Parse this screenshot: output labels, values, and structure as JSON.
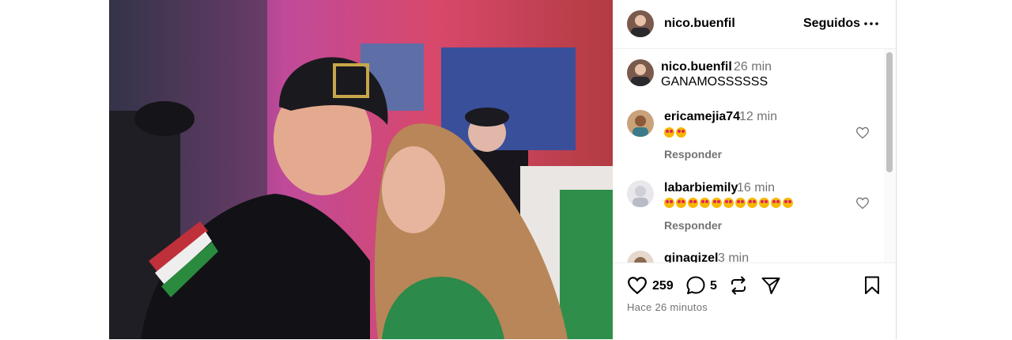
{
  "post": {
    "username": "nico.buenfil",
    "follow_status": "Seguidos",
    "caption": {
      "username": "nico.buenfil",
      "time": "26 min",
      "text": "GANAMOSSSSSS"
    },
    "comments": [
      {
        "username": "ericamejia74",
        "time": "12 min",
        "emoji_count": 2,
        "reply_label": "Responder"
      },
      {
        "username": "labarbiemily",
        "time": "16 min",
        "emoji_count": 11,
        "reply_label": "Responder"
      },
      {
        "username": "ginagizel",
        "time": "3 min"
      }
    ],
    "likes": "259",
    "comment_count": "5",
    "timestamp": "Hace 26 minutos"
  },
  "colors": {
    "muted_text": "#737373",
    "divider": "#efefef",
    "emoji_face": "#f5b800",
    "emoji_heart": "#e0245e"
  }
}
